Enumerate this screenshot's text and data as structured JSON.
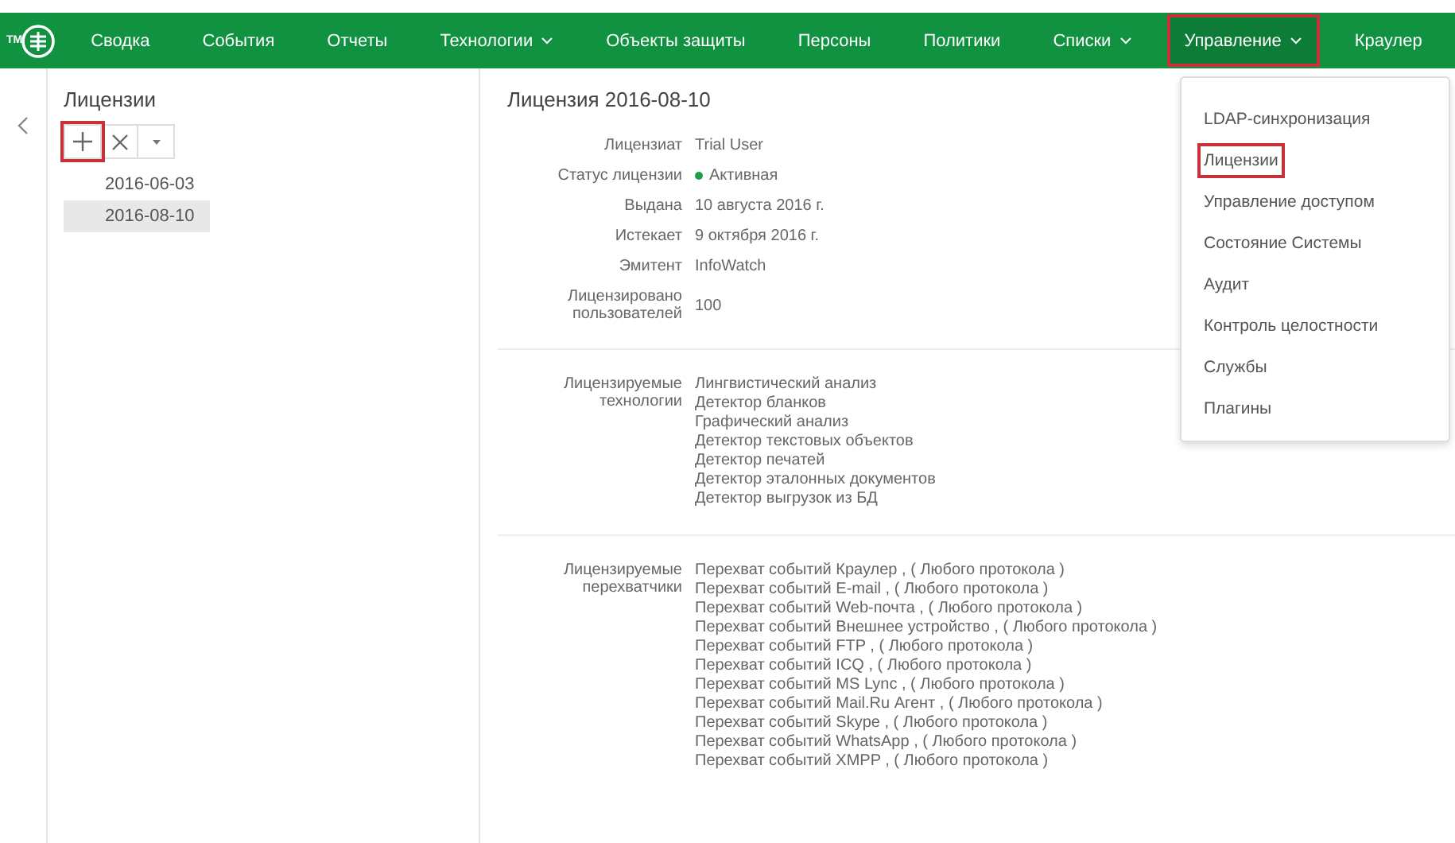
{
  "logo": {
    "mark": "TM"
  },
  "nav": [
    {
      "label": "Сводка",
      "dropdown": false,
      "selected": false,
      "highlighted": false
    },
    {
      "label": "События",
      "dropdown": false,
      "selected": false,
      "highlighted": false
    },
    {
      "label": "Отчеты",
      "dropdown": false,
      "selected": false,
      "highlighted": false
    },
    {
      "label": "Технологии",
      "dropdown": true,
      "selected": false,
      "highlighted": false
    },
    {
      "label": "Объекты защиты",
      "dropdown": false,
      "selected": false,
      "highlighted": false
    },
    {
      "label": "Персоны",
      "dropdown": false,
      "selected": false,
      "highlighted": false
    },
    {
      "label": "Политики",
      "dropdown": false,
      "selected": false,
      "highlighted": false
    },
    {
      "label": "Списки",
      "dropdown": true,
      "selected": false,
      "highlighted": false
    },
    {
      "label": "Управление",
      "dropdown": true,
      "selected": true,
      "highlighted": true
    },
    {
      "label": "Краулер",
      "dropdown": false,
      "selected": false,
      "highlighted": false
    }
  ],
  "sidebar": {
    "title": "Лицензии",
    "toolbar": [
      {
        "kind": "add",
        "highlighted": true
      },
      {
        "kind": "delete",
        "highlighted": false
      },
      {
        "kind": "menu",
        "highlighted": false
      }
    ],
    "items": [
      {
        "label": "2016-06-03",
        "selected": false
      },
      {
        "label": "2016-08-10",
        "selected": true
      }
    ]
  },
  "detail": {
    "title": "Лицензия 2016-08-10",
    "fields": [
      {
        "label": "Лицензиат",
        "value": "Trial User"
      },
      {
        "label": "Статус лицензии",
        "value": "Активная",
        "color": "#1e9e48"
      },
      {
        "label": "Выдана",
        "value": "10 августа 2016 г."
      },
      {
        "label": "Истекает",
        "value": "9 октября 2016 г."
      },
      {
        "label": "Эмитент",
        "value": "InfoWatch"
      },
      {
        "label": "Лицензировано пользователей",
        "value": "100"
      }
    ],
    "sections": [
      {
        "label": "Лицензируемые технологии",
        "items": [
          "Лингвистический анализ",
          "Детектор бланков",
          "Графический анализ",
          "Детектор текстовых объектов",
          "Детектор печатей",
          "Детектор эталонных документов",
          "Детектор выгрузок из БД"
        ]
      },
      {
        "label": "Лицензируемые перехватчики",
        "items": [
          "Перехват событий Краулер , ( Любого протокола )",
          "Перехват событий E-mail , ( Любого протокола )",
          "Перехват событий Web-почта , ( Любого протокола )",
          "Перехват событий Внешнее устройство , ( Любого протокола )",
          "Перехват событий FTP , ( Любого протокола )",
          "Перехват событий ICQ , ( Любого протокола )",
          "Перехват событий MS Lync , ( Любого протокола )",
          "Перехват событий Mail.Ru Агент , ( Любого протокола )",
          "Перехват событий Skype , ( Любого протокола )",
          "Перехват событий WhatsApp , ( Любого протокола )",
          "Перехват событий XMPP , ( Любого протокола )"
        ]
      }
    ]
  },
  "menu": [
    {
      "label": "LDAP-синхронизация",
      "highlighted": false
    },
    {
      "label": "Лицензии",
      "highlighted": true
    },
    {
      "label": "Управление доступом",
      "highlighted": false
    },
    {
      "label": "Состояние Системы",
      "highlighted": false
    },
    {
      "label": "Аудит",
      "highlighted": false
    },
    {
      "label": "Контроль целостности",
      "highlighted": false
    },
    {
      "label": "Службы",
      "highlighted": false
    },
    {
      "label": "Плагины",
      "highlighted": false
    }
  ]
}
